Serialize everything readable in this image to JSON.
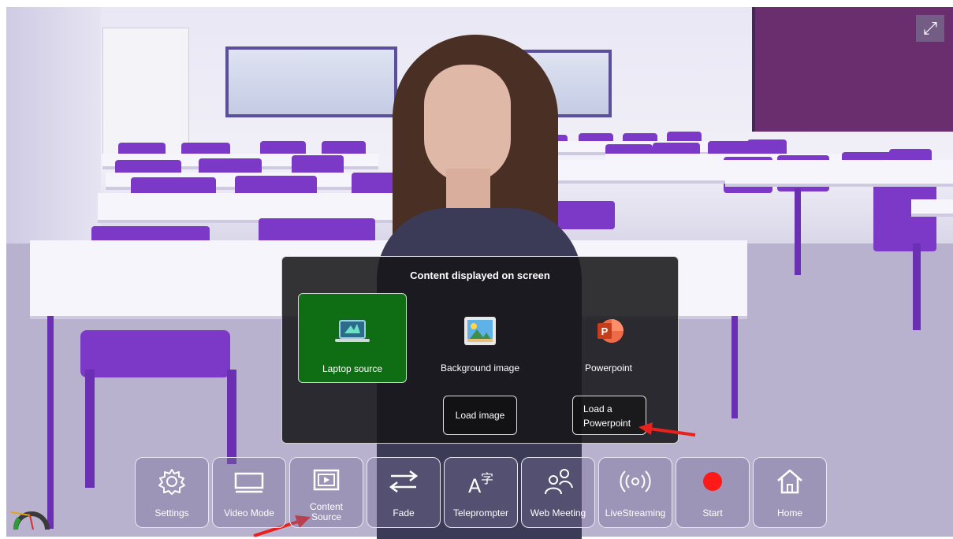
{
  "overlay": {
    "expand_icon": "expand-arrows-icon"
  },
  "panel": {
    "title": "Content displayed on screen",
    "options": [
      {
        "label": "Laptop source",
        "icon": "laptop-icon",
        "selected": true
      },
      {
        "label": "Background image",
        "icon": "image-icon",
        "selected": false
      },
      {
        "label": "Powerpoint",
        "icon": "powerpoint-icon",
        "selected": false
      }
    ],
    "load_image": "Load image",
    "load_powerpoint_line1": "Load a",
    "load_powerpoint_line2": "Powerpoint"
  },
  "toolbar": {
    "settings": "Settings",
    "video_mode": "Video Mode",
    "content_source_line1": "Content",
    "content_source_line2": "Source",
    "fade": "Fade",
    "teleprompter": "Teleprompter",
    "web_meeting": "Web Meeting",
    "livestreaming": "LiveStreaming",
    "start": "Start",
    "home": "Home"
  },
  "colors": {
    "selected_option": "#0f6e14",
    "record_dot": "#ff1a1a",
    "arrow": "#e8211d"
  }
}
